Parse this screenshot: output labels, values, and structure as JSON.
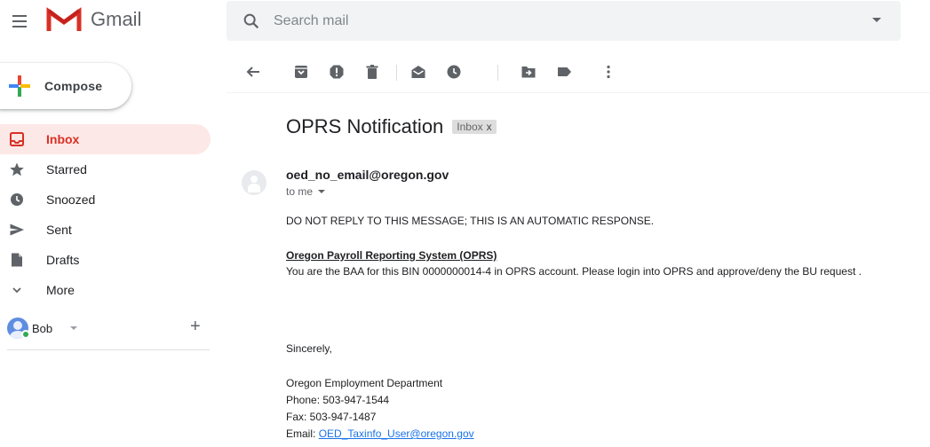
{
  "app": {
    "name": "Gmail"
  },
  "search": {
    "placeholder": "Search mail"
  },
  "compose": {
    "label": "Compose"
  },
  "sidebar": {
    "items": [
      {
        "label": "Inbox",
        "icon": "inbox-icon",
        "active": true
      },
      {
        "label": "Starred",
        "icon": "star-icon"
      },
      {
        "label": "Snoozed",
        "icon": "clock-icon"
      },
      {
        "label": "Sent",
        "icon": "send-icon"
      },
      {
        "label": "Drafts",
        "icon": "draft-icon"
      },
      {
        "label": "More",
        "icon": "chevron-down-icon"
      }
    ],
    "account": {
      "name": "Bob"
    }
  },
  "toolbar": {
    "buttons": [
      "back-arrow-icon",
      "archive-icon",
      "report-spam-icon",
      "delete-icon",
      "mark-unread-icon",
      "snooze-icon",
      "move-to-icon",
      "label-icon",
      "more-vert-icon"
    ]
  },
  "message": {
    "subject": "OPRS Notification",
    "label_chip": "Inbox",
    "label_chip_close": "x",
    "sender": "oed_no_email@oregon.gov",
    "recipient": "to me",
    "body": {
      "line1": "DO NOT REPLY TO THIS MESSAGE; THIS IS AN AUTOMATIC RESPONSE.",
      "heading": "Oregon Payroll Reporting System (OPRS)",
      "line2": "You are the BAA for this BIN 0000000014-4 in OPRS account. Please login into OPRS and approve/deny the BU request .",
      "closing": "Sincerely,",
      "org": "Oregon Employment Department",
      "phone": "Phone: 503-947-1544",
      "fax": "Fax: 503-947-1487",
      "email_prefix": "Email:",
      "email_link": "OED_Taxinfo_User@oregon.gov"
    }
  },
  "colors": {
    "accent_red": "#d93025",
    "active_bg": "#fce8e6",
    "link_blue": "#1a73e8",
    "search_bg": "#f1f3f4"
  }
}
